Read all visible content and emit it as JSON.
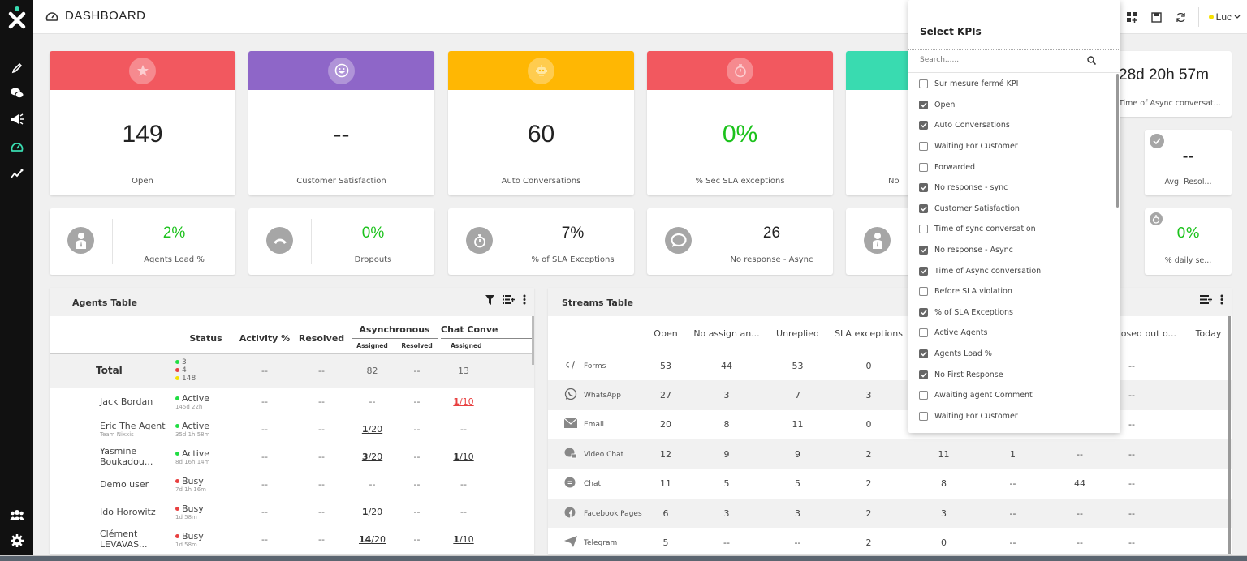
{
  "header": {
    "title": "DASHBOARD",
    "user": "Luc"
  },
  "sidebar": {
    "items": [
      {
        "name": "edit",
        "icon": "pencil-icon"
      },
      {
        "name": "conversations",
        "icon": "chat-bubbles-icon"
      },
      {
        "name": "campaigns",
        "icon": "megaphone-icon"
      },
      {
        "name": "dashboard",
        "icon": "gauge-icon",
        "active": true
      },
      {
        "name": "analytics",
        "icon": "trend-icon"
      }
    ],
    "bottom": [
      {
        "name": "teams",
        "icon": "team-icon"
      },
      {
        "name": "settings",
        "icon": "gear-icon"
      }
    ]
  },
  "colors": {
    "red": "#f2585f",
    "purple": "#8e66c8",
    "yellow": "#ffb703",
    "teal": "#39dbb0",
    "green": "#1cc21c",
    "active_nav": "#39dbb0"
  },
  "kpi_big": [
    {
      "value": "149",
      "label": "Open",
      "icon": "star-icon",
      "color": "#f2585f"
    },
    {
      "value": "--",
      "label": "Customer Satisfaction",
      "icon": "smiley-icon",
      "color": "#8e66c8"
    },
    {
      "value": "60",
      "label": "Auto Conversations",
      "icon": "robot-icon",
      "color": "#ffb703"
    },
    {
      "value": "0%",
      "label": "% Sec SLA exceptions",
      "icon": "stopwatch-icon",
      "color": "#f2585f"
    },
    {
      "value": "",
      "label": "No",
      "icon": "",
      "color": "#39dbb0"
    }
  ],
  "kpi_right": {
    "time_async": {
      "value": "28d 20h 57m",
      "label": "Time of Async conversat..."
    },
    "avg_resol": {
      "value": "--",
      "label": "Avg. Resol..."
    },
    "daily": {
      "value": "0%",
      "label": "% daily se..."
    }
  },
  "kpi_small": [
    {
      "value": "2%",
      "label": "Agents Load %",
      "icon": "agent-icon",
      "green": true
    },
    {
      "value": "0%",
      "label": "Dropouts",
      "icon": "hangup-icon",
      "green": true
    },
    {
      "value": "7%",
      "label": "% of SLA Exceptions",
      "icon": "stopwatch-icon",
      "green": false
    },
    {
      "value": "26",
      "label": "No response - Async",
      "icon": "speech-bubble-icon",
      "green": false
    }
  ],
  "agents_table": {
    "title": "Agents Table",
    "headers": {
      "status": "Status",
      "activity": "Activity %",
      "resolved": "Resolved",
      "async": "Asynchronous",
      "chat": "Chat Conve",
      "assigned": "Assigned",
      "resolved_sub": "Resolved"
    },
    "total": {
      "label": "Total",
      "green": "3",
      "red": "4",
      "yellow": "148",
      "activity": "--",
      "resolved": "--",
      "async_assigned": "82",
      "async_resolved": "--",
      "chat_assigned": "13"
    },
    "rows": [
      {
        "name": "Jack Bordan",
        "team": "",
        "status": "Active",
        "since": "145d 22h",
        "activity": "--",
        "resolved": "--",
        "async_assigned": "--",
        "async_resolved": "--",
        "chat_assigned": "1/10"
      },
      {
        "name": "Eric The Agent",
        "team": "Team Nixxis",
        "status": "Active",
        "since": "35d 1h 58m",
        "activity": "--",
        "resolved": "--",
        "async_assigned": "1/20",
        "async_resolved": "--",
        "chat_assigned": "--"
      },
      {
        "name": "Yasmine Boukadou...",
        "team": "",
        "status": "Active",
        "since": "8d 16h 14m",
        "activity": "--",
        "resolved": "--",
        "async_assigned": "3/20",
        "async_resolved": "--",
        "chat_assigned": "1/10"
      },
      {
        "name": "Demo user",
        "team": "",
        "status": "Busy",
        "since": "7d 1h 16m",
        "activity": "--",
        "resolved": "--",
        "async_assigned": "--",
        "async_resolved": "--",
        "chat_assigned": "--"
      },
      {
        "name": "Ido Horowitz",
        "team": "",
        "status": "Busy",
        "since": "1d 58m",
        "activity": "--",
        "resolved": "--",
        "async_assigned": "1/20",
        "async_resolved": "--",
        "chat_assigned": "--"
      },
      {
        "name": "Clément LEVAVAS...",
        "team": "",
        "status": "Busy",
        "since": "1d 58m",
        "activity": "--",
        "resolved": "--",
        "async_assigned": "14/20",
        "async_resolved": "--",
        "chat_assigned": "1/10"
      }
    ]
  },
  "streams_table": {
    "title": "Streams Table",
    "headers": [
      "Open",
      "No assign an...",
      "Unreplied",
      "SLA exceptions",
      "",
      "",
      "",
      "Closed out o...",
      "Today"
    ],
    "rows": [
      {
        "name": "Forms",
        "icon": "form-icon",
        "cells": [
          "53",
          "44",
          "53",
          "0",
          "",
          "",
          "",
          "--"
        ]
      },
      {
        "name": "WhatsApp",
        "icon": "whatsapp-icon",
        "cells": [
          "27",
          "3",
          "7",
          "3",
          "",
          "",
          "",
          "--"
        ]
      },
      {
        "name": "Email",
        "icon": "email-icon",
        "cells": [
          "20",
          "8",
          "11",
          "0",
          "",
          "",
          "",
          "--"
        ]
      },
      {
        "name": "Video Chat",
        "icon": "video-chat-icon",
        "cells": [
          "12",
          "9",
          "9",
          "2",
          "11",
          "1",
          "--",
          "--"
        ]
      },
      {
        "name": "Chat",
        "icon": "chat-icon",
        "cells": [
          "11",
          "5",
          "5",
          "2",
          "8",
          "--",
          "44",
          "--"
        ]
      },
      {
        "name": "Facebook Pages",
        "icon": "facebook-icon",
        "cells": [
          "6",
          "3",
          "3",
          "2",
          "3",
          "--",
          "--",
          "--"
        ]
      },
      {
        "name": "Telegram",
        "icon": "telegram-icon",
        "cells": [
          "5",
          "--",
          "--",
          "2",
          "0",
          "--",
          "--",
          "--"
        ]
      }
    ]
  },
  "kpi_selector": {
    "title": "Select KPIs",
    "search_placeholder": "Search......",
    "items": [
      {
        "label": "Sur mesure fermé KPI",
        "checked": false
      },
      {
        "label": "Open",
        "checked": true
      },
      {
        "label": "Auto Conversations",
        "checked": true
      },
      {
        "label": "Waiting For Customer",
        "checked": false
      },
      {
        "label": "Forwarded",
        "checked": false
      },
      {
        "label": "No response - sync",
        "checked": true
      },
      {
        "label": "Customer Satisfaction",
        "checked": true
      },
      {
        "label": "Time of sync conversation",
        "checked": false
      },
      {
        "label": "No response - Async",
        "checked": true
      },
      {
        "label": "Time of Async conversation",
        "checked": true
      },
      {
        "label": "Before SLA violation",
        "checked": false
      },
      {
        "label": "% of SLA Exceptions",
        "checked": true
      },
      {
        "label": "Active Agents",
        "checked": false
      },
      {
        "label": "Agents Load %",
        "checked": true
      },
      {
        "label": "No First Response",
        "checked": true
      },
      {
        "label": "Awaiting agent Comment",
        "checked": false
      },
      {
        "label": "Waiting For Customer",
        "checked": false
      }
    ]
  }
}
